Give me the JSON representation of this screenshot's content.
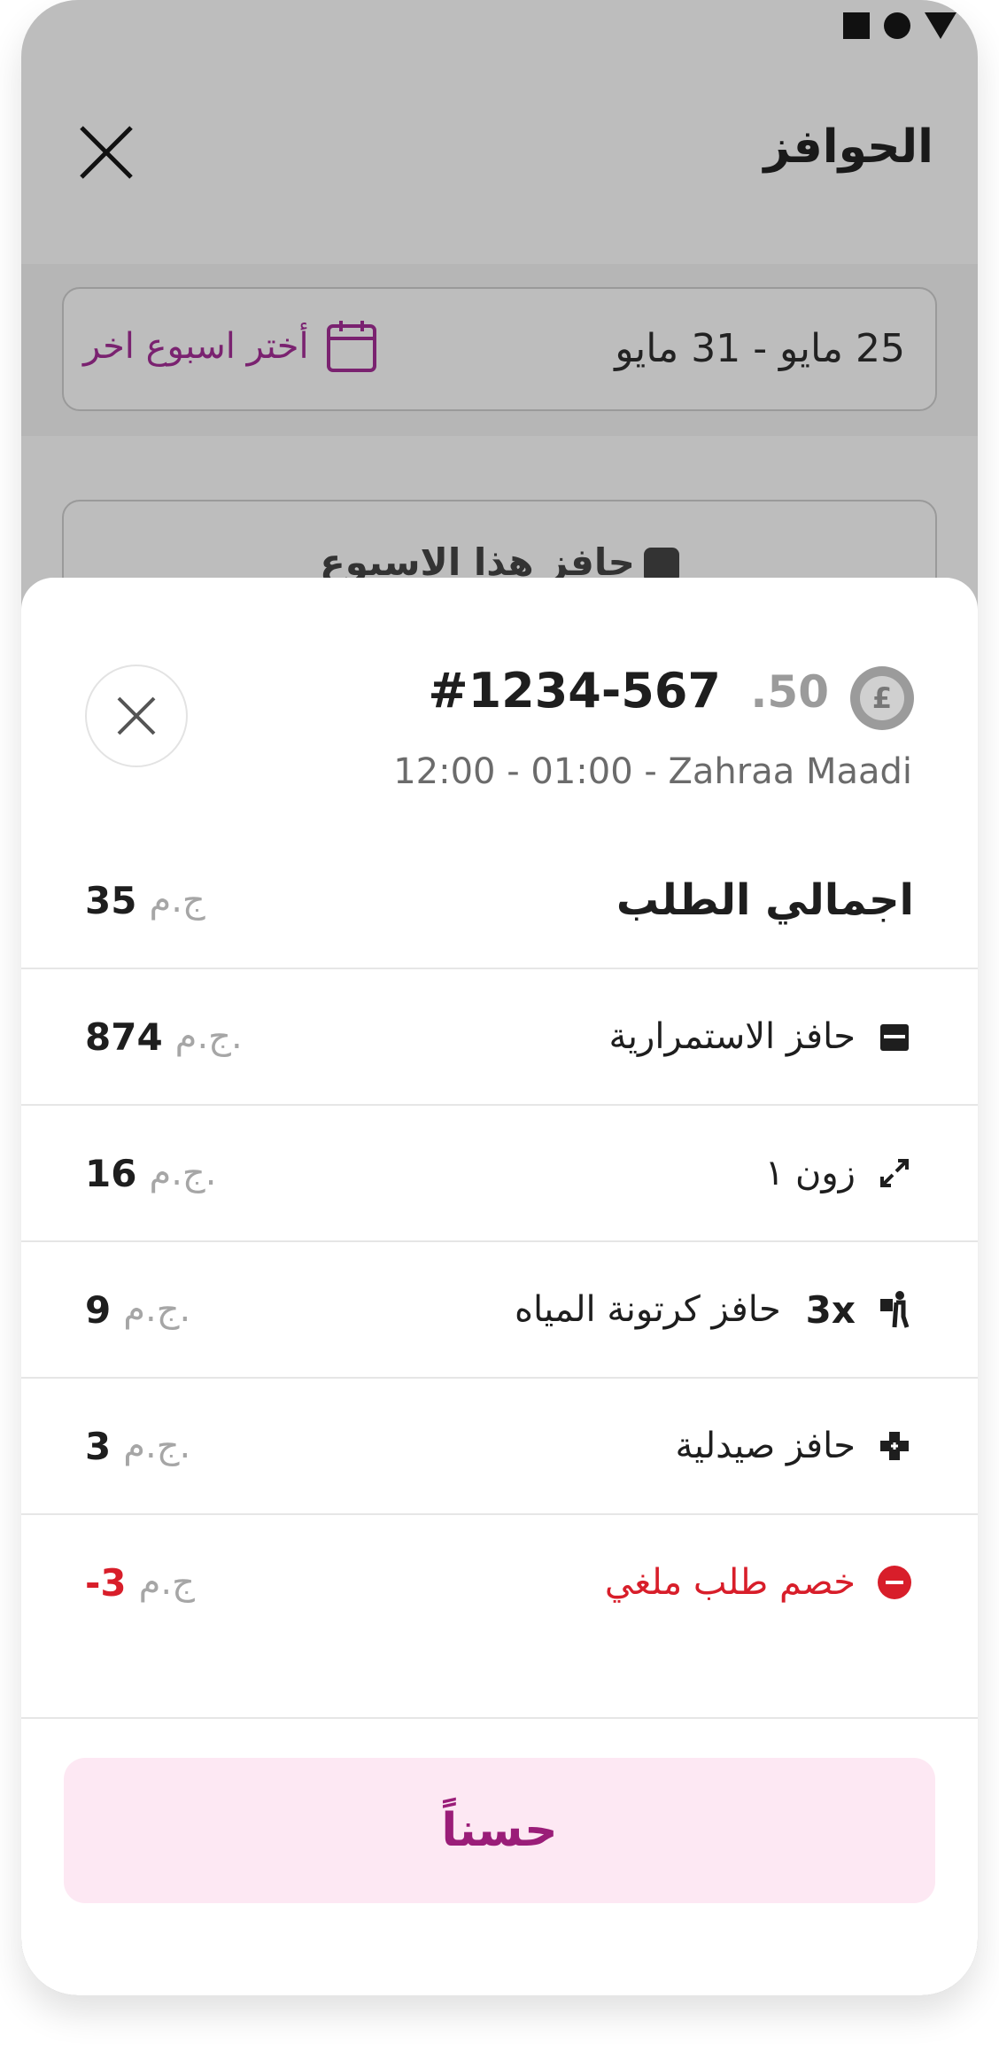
{
  "status_bar": {
    "icons": [
      "square-icon",
      "circle-icon",
      "triangle-icon"
    ]
  },
  "header": {
    "title": "الحوافز"
  },
  "week_selector": {
    "date_range": "25 مايو - 31 مايو",
    "pick_label": "أختر اسبوع اخر"
  },
  "incentive_card": {
    "label": "حافز هذا الاسبوع"
  },
  "sheet": {
    "amount_fraction": ".50",
    "order_id": "#1234-567",
    "order_subtitle": "12:00 - 01:00  -  Zahraa Maadi",
    "currency_icon": "pound-coin-icon",
    "total": {
      "label": "اجمالي الطلب",
      "currency": "ج.م",
      "value": "35"
    },
    "items": [
      {
        "icon": "calendar-incentive-icon",
        "label": "حافز الاستمرارية",
        "multiplier": "",
        "currency": "ج.م.",
        "value": "874",
        "negative": false
      },
      {
        "icon": "zone-expand-icon",
        "label": "زون ١",
        "multiplier": "",
        "currency": "ج.م.",
        "value": "16",
        "negative": false
      },
      {
        "icon": "water-carrier-icon",
        "label": "حافز كرتونة المياه",
        "multiplier": "3x",
        "currency": "ج.م.",
        "value": "9",
        "negative": false
      },
      {
        "icon": "pharmacy-icon",
        "label": "حافز صيدلية",
        "multiplier": "",
        "currency": "ج.م.",
        "value": "3",
        "negative": false
      },
      {
        "icon": "minus-circle-icon",
        "label": "خصم طلب ملغي",
        "multiplier": "",
        "currency": "ج.م",
        "value": "-3",
        "negative": true
      }
    ],
    "ok_label": "حسناً"
  },
  "colors": {
    "brand": "#9a1d78",
    "brand_light": "#fde8f3",
    "negative": "#d81e2a",
    "overlay": "#bdbdbd"
  }
}
